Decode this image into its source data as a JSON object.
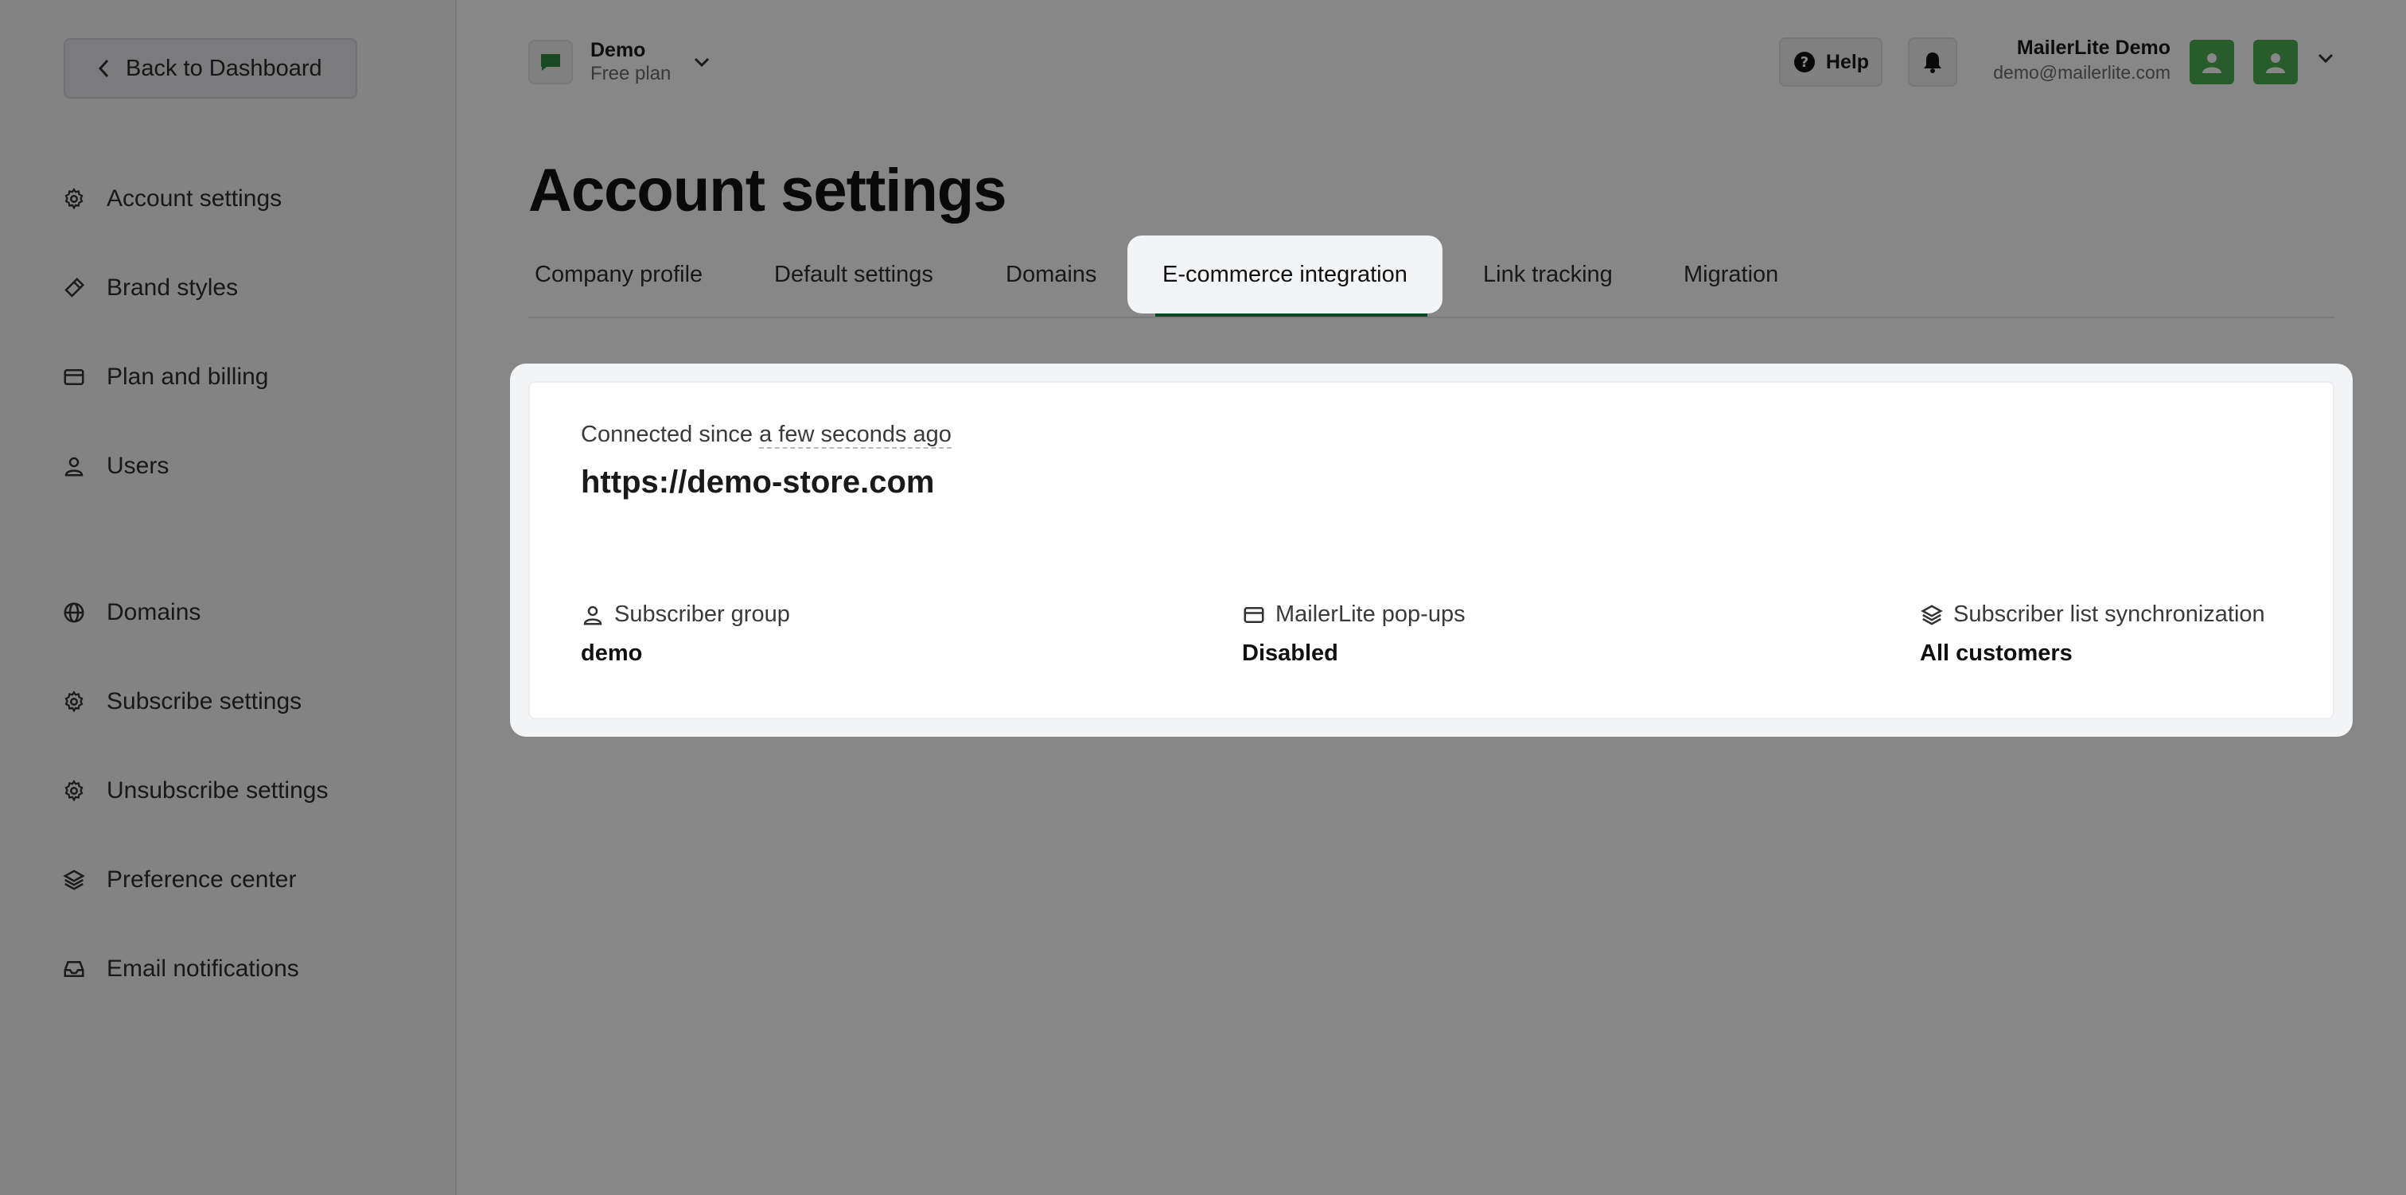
{
  "sidebar": {
    "back_label": "Back to Dashboard",
    "items": [
      {
        "label": "Account settings",
        "icon": "gear-icon"
      },
      {
        "label": "Brand styles",
        "icon": "brush-icon"
      },
      {
        "label": "Plan and billing",
        "icon": "credit-card-icon"
      },
      {
        "label": "Users",
        "icon": "user-icon"
      },
      {
        "label": "Domains",
        "icon": "globe-icon"
      },
      {
        "label": "Subscribe settings",
        "icon": "gear-icon"
      },
      {
        "label": "Unsubscribe settings",
        "icon": "gear-icon"
      },
      {
        "label": "Preference center",
        "icon": "layers-icon"
      },
      {
        "label": "Email notifications",
        "icon": "inbox-icon"
      }
    ]
  },
  "header": {
    "workspace_name": "Demo",
    "workspace_plan": "Free plan",
    "help_label": "Help",
    "user_name": "MailerLite Demo",
    "user_email": "demo@mailerlite.com"
  },
  "main": {
    "title": "Account settings",
    "tabs": [
      {
        "label": "Company profile"
      },
      {
        "label": "Default settings"
      },
      {
        "label": "Domains"
      },
      {
        "label": "E-commerce integration",
        "active": true
      },
      {
        "label": "Link tracking"
      },
      {
        "label": "Migration"
      }
    ],
    "integration": {
      "connected_prefix": "Connected since",
      "connected_time": "a few seconds ago",
      "store_url": "https://demo-store.com",
      "subscriber_group_label": "Subscriber group",
      "subscriber_group_value": "demo",
      "popups_label": "MailerLite pop-ups",
      "popups_value": "Disabled",
      "sync_label": "Subscriber list synchronization",
      "sync_value": "All customers"
    }
  },
  "colors": {
    "accent": "#0b8a4a",
    "avatar": "#4caf50",
    "overlay": "#000000"
  }
}
